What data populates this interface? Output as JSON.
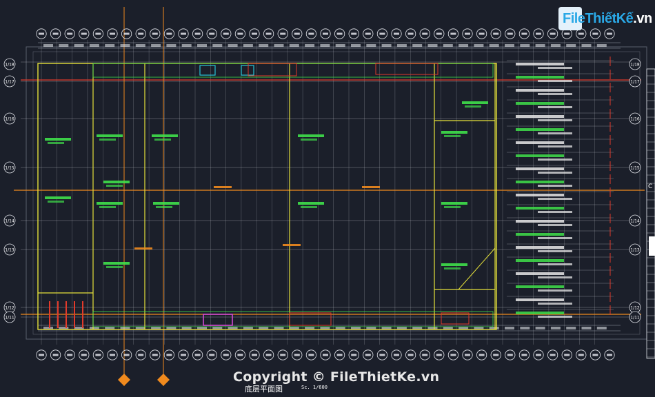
{
  "watermark": {
    "logo_text": "FileThiếtKế",
    "logo_suffix": ".vn",
    "copyright": "Copyright © FileThietKe.vn"
  },
  "drawing": {
    "title_cn": "底层平面图",
    "scale": "Sc. 1/600",
    "sheet_mark": "C",
    "row_labels": [
      "1/18",
      "1/17",
      "1/16",
      "1/15",
      "1/14",
      "1/13",
      "1/12",
      "1/11"
    ],
    "colors": {
      "background": "#1b1f2a",
      "grid": "#c8cbd2",
      "wall_yellow": "#e6e23a",
      "annotation_green": "#3fe04a",
      "accent_red": "#e23a2a",
      "accent_orange": "#f08a1e",
      "magenta": "#d24ad2",
      "cyan": "#27c6d8"
    }
  }
}
